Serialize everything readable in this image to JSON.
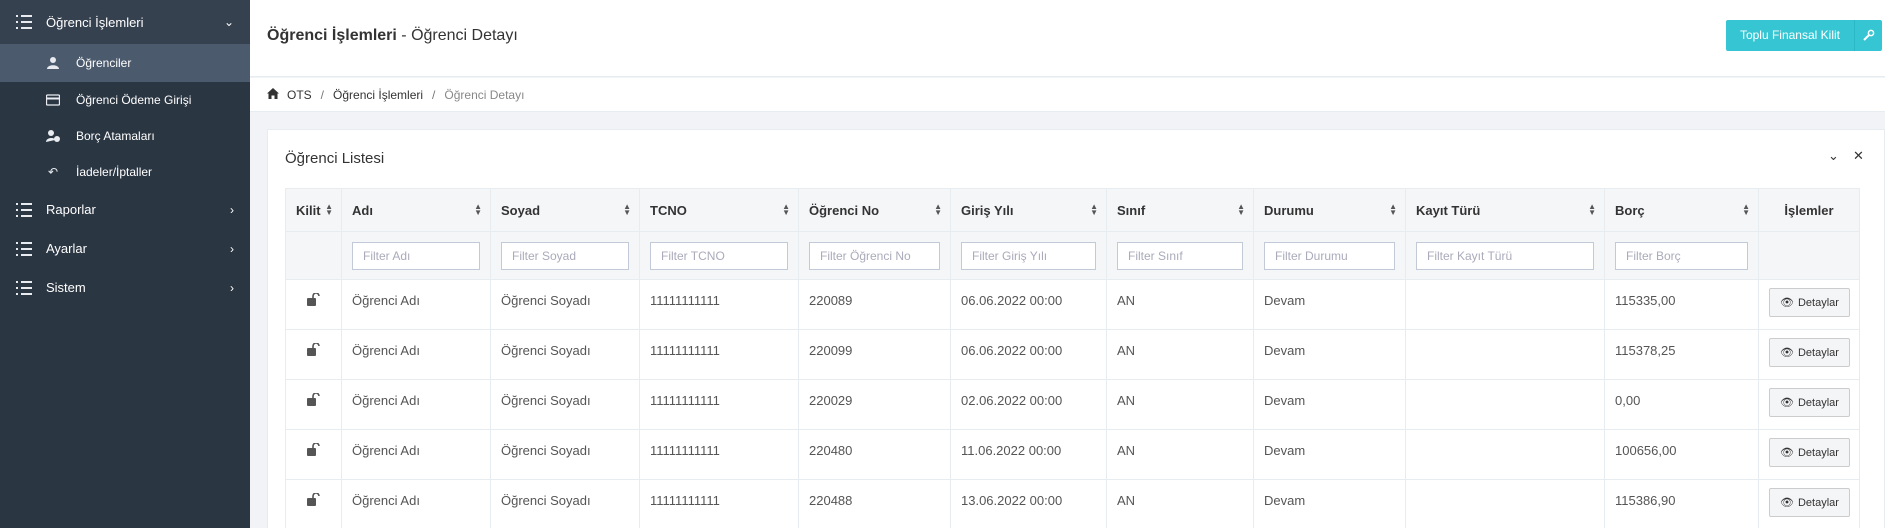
{
  "sidebar": {
    "group_students": {
      "label": "Öğrenci İşlemleri",
      "icon": "list-icon"
    },
    "items": [
      {
        "label": "Öğrenciler",
        "icon": "user-icon"
      },
      {
        "label": "Öğrenci Ödeme Girişi",
        "icon": "credit-card-icon"
      },
      {
        "label": "Borç Atamaları",
        "icon": "user-coin-icon"
      },
      {
        "label": "İadeler/İptaller",
        "icon": "undo-icon"
      }
    ],
    "groups": [
      {
        "label": "Raporlar"
      },
      {
        "label": "Ayarlar"
      },
      {
        "label": "Sistem"
      }
    ]
  },
  "header": {
    "title_bold": "Öğrenci İşlemleri",
    "title_rest": " - Öğrenci Detayı",
    "lock_button": "Toplu Finansal Kilit"
  },
  "breadcrumb": [
    "OTS",
    "Öğrenci İşlemleri",
    "Öğrenci Detayı"
  ],
  "portlet": {
    "title": "Öğrenci Listesi"
  },
  "table": {
    "columns": [
      "Kilit",
      "Adı",
      "Soyad",
      "TCNO",
      "Öğrenci No",
      "Giriş Yılı",
      "Sınıf",
      "Durumu",
      "Kayıt Türü",
      "Borç",
      "İşlemler"
    ],
    "filters": [
      "Filter Adı",
      "Filter Soyad",
      "Filter TCNO",
      "Filter Öğrenci No",
      "Filter Giriş Yılı",
      "Filter Sınıf",
      "Filter Durumu",
      "Filter Kayıt Türü",
      "Filter Borç"
    ],
    "action_label": "Detaylar",
    "rows": [
      {
        "ad": "Öğrenci Adı",
        "soyad": "Öğrenci Soyadı",
        "tcno": "11111111111",
        "no": "220089",
        "giris": "06.06.2022 00:00",
        "sinif": "AN",
        "durum": "Devam",
        "kayit": "",
        "borc": "115335,00"
      },
      {
        "ad": "Öğrenci Adı",
        "soyad": "Öğrenci Soyadı",
        "tcno": "11111111111",
        "no": "220099",
        "giris": "06.06.2022 00:00",
        "sinif": "AN",
        "durum": "Devam",
        "kayit": "",
        "borc": "115378,25"
      },
      {
        "ad": "Öğrenci Adı",
        "soyad": "Öğrenci Soyadı",
        "tcno": "11111111111",
        "no": "220029",
        "giris": "02.06.2022 00:00",
        "sinif": "AN",
        "durum": "Devam",
        "kayit": "",
        "borc": "0,00"
      },
      {
        "ad": "Öğrenci Adı",
        "soyad": "Öğrenci Soyadı",
        "tcno": "11111111111",
        "no": "220480",
        "giris": "11.06.2022 00:00",
        "sinif": "AN",
        "durum": "Devam",
        "kayit": "",
        "borc": "100656,00"
      },
      {
        "ad": "Öğrenci Adı",
        "soyad": "Öğrenci Soyadı",
        "tcno": "11111111111",
        "no": "220488",
        "giris": "13.06.2022 00:00",
        "sinif": "AN",
        "durum": "Devam",
        "kayit": "",
        "borc": "115386,90"
      }
    ]
  }
}
